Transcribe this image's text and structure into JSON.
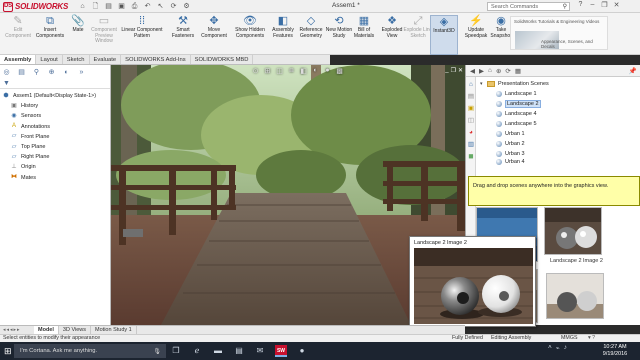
{
  "app": {
    "logo_text": "SOLIDWORKS",
    "document_title": "Assem1 *",
    "search_placeholder": "Search Commands",
    "brand_color": "#c8102e"
  },
  "commands": [
    {
      "label": "Edit Component",
      "icon": "edit-component-icon",
      "enabled": false
    },
    {
      "label": "Insert Components",
      "icon": "insert-components-icon",
      "enabled": true
    },
    {
      "label": "Mate",
      "icon": "mate-icon",
      "enabled": true
    },
    {
      "label": "Component Preview Window",
      "icon": "preview-window-icon",
      "enabled": false
    },
    {
      "label": "Linear Component Pattern",
      "icon": "linear-pattern-icon",
      "enabled": true
    },
    {
      "label": "Smart Fasteners",
      "icon": "smart-fasteners-icon",
      "enabled": true
    },
    {
      "label": "Move Component",
      "icon": "move-component-icon",
      "enabled": true
    },
    {
      "label": "Show Hidden Components",
      "icon": "show-hidden-icon",
      "enabled": true
    },
    {
      "label": "Assembly Features",
      "icon": "assembly-features-icon",
      "enabled": true
    },
    {
      "label": "Reference Geometry",
      "icon": "reference-geometry-icon",
      "enabled": true
    },
    {
      "label": "New Motion Study",
      "icon": "motion-study-icon",
      "enabled": true
    },
    {
      "label": "Bill of Materials",
      "icon": "bom-icon",
      "enabled": true
    },
    {
      "label": "Exploded View",
      "icon": "exploded-view-icon",
      "enabled": true
    },
    {
      "label": "Explode Line Sketch",
      "icon": "explode-line-icon",
      "enabled": false
    },
    {
      "label": "Instant3D",
      "icon": "instant3d-icon",
      "enabled": true,
      "active": true
    },
    {
      "label": "Update Speedpak",
      "icon": "speedpak-icon",
      "enabled": true
    },
    {
      "label": "Take Snapshot",
      "icon": "snapshot-icon",
      "enabled": true
    }
  ],
  "tutorial": {
    "title": "SolidWorks Tutorials & Engineering Videos",
    "caption": "Appearance, Scenes, and Decals"
  },
  "tabs": [
    "Assembly",
    "Layout",
    "Sketch",
    "Evaluate",
    "SOLIDWORKS Add-Ins",
    "SOLIDWORKS MBD"
  ],
  "tree": {
    "root": "Assem1  (Default<Display State-1>)",
    "items": [
      {
        "label": "History",
        "icon": "history-icon"
      },
      {
        "label": "Sensors",
        "icon": "sensors-icon"
      },
      {
        "label": "Annotations",
        "icon": "annotations-icon"
      },
      {
        "label": "Front Plane",
        "icon": "plane-icon"
      },
      {
        "label": "Top Plane",
        "icon": "plane-icon"
      },
      {
        "label": "Right Plane",
        "icon": "plane-icon"
      },
      {
        "label": "Origin",
        "icon": "origin-icon"
      },
      {
        "label": "Mates",
        "icon": "mates-icon"
      }
    ]
  },
  "scenes": {
    "folder": "Presentation Scenes",
    "items": [
      "Landscape 1",
      "Landscape 2",
      "Landscape 4",
      "Landscape 5",
      "Urban 1",
      "Urban 2",
      "Urban 3",
      "Urban 4"
    ],
    "selected_index": 1,
    "tooltip": "Drag and drop scenes anywhere into the graphics view.",
    "thumb_label": "Landscape 2 Image 2"
  },
  "preview": {
    "title": "Landscape 2 Image 2"
  },
  "bottom_tabs": [
    "Model",
    "3D Views",
    "Motion Study 1"
  ],
  "status": {
    "left": "Select entities to modify their appearance",
    "mode": "Fully Defined",
    "editing": "Editing Assembly",
    "units": "MMGS"
  },
  "taskbar": {
    "search_text": "I'm Cortana. Ask me anything.",
    "time": "10:27 AM",
    "date": "9/19/2016"
  }
}
